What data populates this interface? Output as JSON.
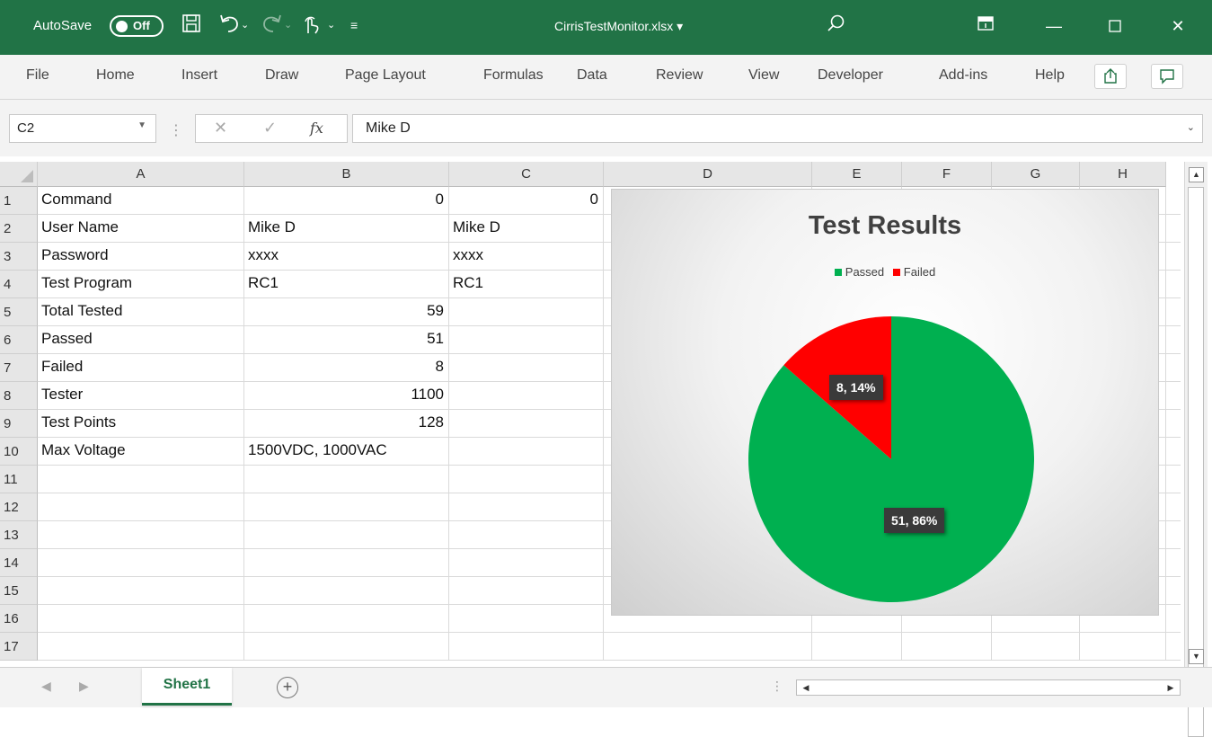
{
  "titlebar": {
    "autosave_label": "AutoSave",
    "autosave_state": "Off",
    "filename": "CirrisTestMonitor.xlsx",
    "filename_caret": "▾"
  },
  "ribbon": {
    "tabs": [
      "File",
      "Home",
      "Insert",
      "Draw",
      "Page Layout",
      "Formulas",
      "Data",
      "Review",
      "View",
      "Developer",
      "Add-ins",
      "Help"
    ]
  },
  "formula_bar": {
    "name_box": "C2",
    "cancel_symbol": "✕",
    "enter_symbol": "✓",
    "fx_label": "fx",
    "value": "Mike D"
  },
  "columns": [
    "A",
    "B",
    "C",
    "D",
    "E",
    "F",
    "G",
    "H"
  ],
  "rows": [
    "1",
    "2",
    "3",
    "4",
    "5",
    "6",
    "7",
    "8",
    "9",
    "10",
    "11",
    "12",
    "13",
    "14",
    "15",
    "16",
    "17"
  ],
  "cells": {
    "a": [
      "Command",
      "User Name",
      "Password",
      "Test Program",
      "Total Tested",
      "Passed",
      "Failed",
      "Tester",
      "Test Points",
      "Max Voltage"
    ],
    "b": [
      "0",
      "Mike D",
      "xxxx",
      "RC1",
      "59",
      "51",
      "8",
      "1100",
      "128",
      "1500VDC, 1000VAC"
    ],
    "c": [
      "0",
      "Mike D",
      "xxxx",
      "RC1"
    ]
  },
  "chart_data": {
    "type": "pie",
    "title": "Test Results",
    "categories": [
      "Passed",
      "Failed"
    ],
    "values": [
      51,
      8
    ],
    "percent_labels": [
      "86%",
      "14%"
    ],
    "data_labels": [
      "51, 86%",
      "8, 14%"
    ],
    "colors": [
      "#00b050",
      "#ff0000"
    ],
    "legend_position": "top"
  },
  "sheets": {
    "active": "Sheet1"
  }
}
